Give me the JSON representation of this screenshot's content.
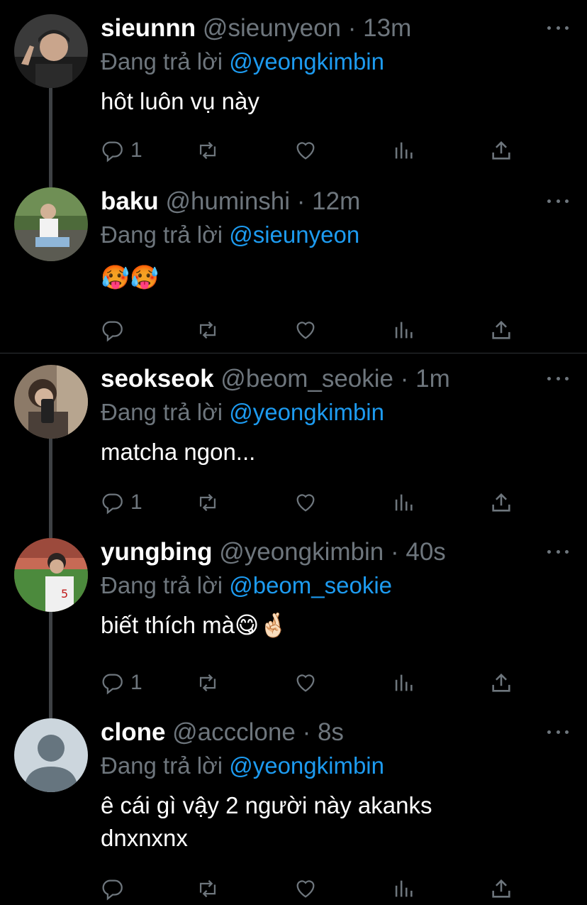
{
  "tweets": [
    {
      "name": "sieunnn",
      "handle": "@sieunyeon",
      "sep": "·",
      "time": "13m",
      "reply_prefix": "Đang trả lời",
      "reply_to": "@yeongkimbin",
      "text": "hôt luôn vụ này",
      "reply_count": "1",
      "avatar_icon": "person-photo-avatar-icon"
    },
    {
      "name": "baku",
      "handle": "@huminshi",
      "sep": "·",
      "time": "12m",
      "reply_prefix": "Đang trả lời",
      "reply_to": "@sieunyeon",
      "text": "🥵🥵",
      "reply_count": "",
      "avatar_icon": "person-photo-avatar-icon"
    },
    {
      "name": "seokseok",
      "handle": "@beom_seokie",
      "sep": "·",
      "time": "1m",
      "reply_prefix": "Đang trả lời",
      "reply_to": "@yeongkimbin",
      "text": "matcha ngon...",
      "reply_count": "1",
      "avatar_icon": "person-photo-avatar-icon"
    },
    {
      "name": "yungbing",
      "handle": "@yeongkimbin",
      "sep": "·",
      "time": "40s",
      "reply_prefix": "Đang trả lời",
      "reply_to": "@beom_seokie",
      "text": "biết thích mà😋🤞🏻",
      "reply_count": "1",
      "avatar_icon": "person-photo-avatar-icon"
    },
    {
      "name": "clone",
      "handle": "@accclone",
      "sep": "·",
      "time": "8s",
      "reply_prefix": "Đang trả lời",
      "reply_to": "@yeongkimbin",
      "text": "ê cái gì vậy 2 người này akanks\ndnxnxnx",
      "reply_count": "",
      "avatar_icon": "default-avatar-icon"
    }
  ],
  "icons": {
    "reply": "reply-icon",
    "retweet": "retweet-icon",
    "like": "heart-icon",
    "analytics": "analytics-icon",
    "share": "share-icon",
    "more": "more-dots-icon"
  },
  "colors": {
    "background": "#000000",
    "secondary_text": "#6e767d",
    "mention": "#1d9bf0",
    "divider": "#2f3336"
  }
}
